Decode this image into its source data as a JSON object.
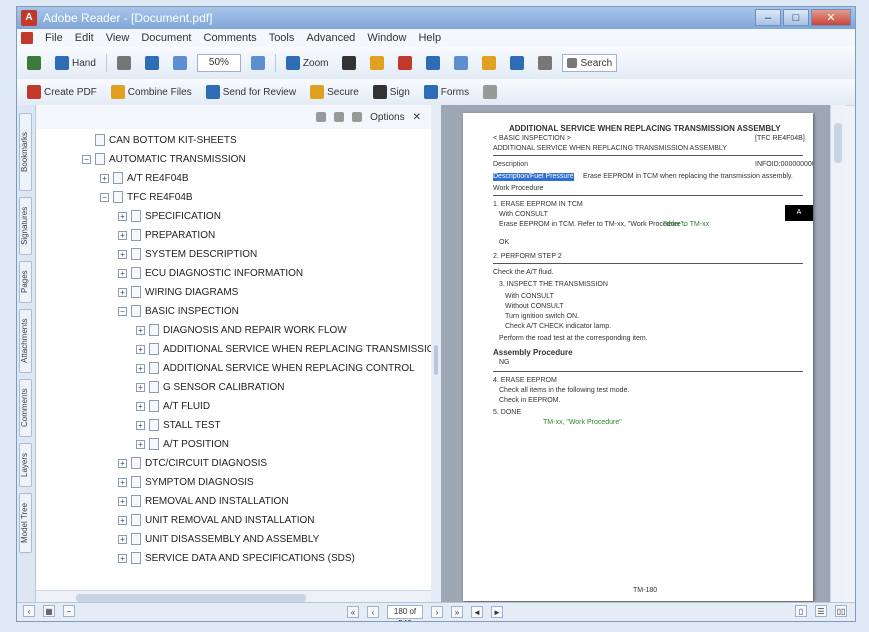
{
  "window": {
    "title": "Adobe Reader - [Document.pdf]",
    "icon": "adobe-reader-icon"
  },
  "window_buttons": {
    "minimize": "–",
    "maximize": "□",
    "close": "✕"
  },
  "menubar": {
    "items": [
      "File",
      "Edit",
      "View",
      "Document",
      "Comments",
      "Tools",
      "Advanced",
      "Window",
      "Help"
    ]
  },
  "toolbar1": {
    "items": [
      {
        "label": "",
        "icon": "save-icon",
        "color": "#3b7a3b"
      },
      {
        "label": "Hand",
        "icon": "hand-icon",
        "color": "#2e6db5"
      },
      {
        "label": "",
        "icon": "select-icon",
        "color": "#555"
      },
      {
        "label": "",
        "icon": "zoom-icon",
        "color": "#2e6db5"
      },
      {
        "label": "",
        "icon": "page-icon",
        "color": "#2e6db5"
      },
      {
        "label": "",
        "icon": "rotate-icon",
        "color": "#2e6db5"
      }
    ],
    "zoom": "50%",
    "right_items": [
      {
        "label": "Zoom",
        "icon": "zoom-in-icon",
        "color": "#2e6db5"
      },
      {
        "label": "",
        "icon": "monitor-icon",
        "color": "#333"
      },
      {
        "label": "",
        "icon": "folder-icon",
        "color": "#e0a020"
      },
      {
        "label": "",
        "icon": "print-icon",
        "color": "#c0392b"
      },
      {
        "label": "",
        "icon": "email-icon",
        "color": "#2e6db5"
      },
      {
        "label": "",
        "icon": "page-icon",
        "color": "#2e6db5"
      },
      {
        "label": "",
        "icon": "highlight-icon",
        "color": "#e0a020"
      },
      {
        "label": "",
        "icon": "pencil-icon",
        "color": "#2e6db5"
      },
      {
        "label": "",
        "icon": "lock-icon",
        "color": "#777"
      }
    ],
    "search_label": "Search"
  },
  "toolbar2": {
    "items": [
      {
        "label": "Create PDF",
        "icon": "create-pdf-icon",
        "color": "#c0392b"
      },
      {
        "label": "Combine Files",
        "icon": "combine-icon",
        "color": "#e0a020"
      },
      {
        "label": "Send for Review",
        "icon": "review-icon",
        "color": "#2e6db5"
      },
      {
        "label": "Secure",
        "icon": "lock-icon",
        "color": "#e0a020"
      },
      {
        "label": "Sign",
        "icon": "pen-icon",
        "color": "#333"
      },
      {
        "label": "Forms",
        "icon": "forms-icon",
        "color": "#2e6db5"
      },
      {
        "label": "",
        "icon": "more-icon",
        "color": "#333"
      }
    ]
  },
  "left_strip": {
    "tabs": [
      "Bookmarks",
      "Signatures",
      "Pages",
      "Attachments",
      "Comments",
      "Layers",
      "Model Tree"
    ]
  },
  "bookmarks_toolbar": {
    "options_label": "Options"
  },
  "bookmarks": [
    {
      "label": "CAN BOTTOM KIT-SHEETS",
      "level": 0,
      "expander": ""
    },
    {
      "label": "AUTOMATIC TRANSMISSION",
      "level": 0,
      "expander": "−"
    },
    {
      "label": "A/T RE4F04B",
      "level": 1,
      "expander": "+"
    },
    {
      "label": "TFC RE4F04B",
      "level": 1,
      "expander": "−"
    },
    {
      "label": "SPECIFICATION",
      "level": 2,
      "expander": "+"
    },
    {
      "label": "PREPARATION",
      "level": 2,
      "expander": "+"
    },
    {
      "label": "SYSTEM DESCRIPTION",
      "level": 2,
      "expander": "+"
    },
    {
      "label": "ECU DIAGNOSTIC INFORMATION",
      "level": 2,
      "expander": "+"
    },
    {
      "label": "WIRING DIAGRAMS",
      "level": 2,
      "expander": "+"
    },
    {
      "label": "BASIC INSPECTION",
      "level": 2,
      "expander": "−"
    },
    {
      "label": "DIAGNOSIS AND REPAIR WORK FLOW",
      "level": 3,
      "expander": "+"
    },
    {
      "label": "ADDITIONAL SERVICE WHEN REPLACING TRANSMISSION",
      "level": 3,
      "expander": "+"
    },
    {
      "label": "ADDITIONAL SERVICE WHEN REPLACING CONTROL",
      "level": 3,
      "expander": "+"
    },
    {
      "label": "G SENSOR CALIBRATION",
      "level": 3,
      "expander": "+"
    },
    {
      "label": "A/T FLUID",
      "level": 3,
      "expander": "+"
    },
    {
      "label": "STALL TEST",
      "level": 3,
      "expander": "+"
    },
    {
      "label": "A/T POSITION",
      "level": 3,
      "expander": "+"
    },
    {
      "label": "DTC/CIRCUIT DIAGNOSIS",
      "level": 2,
      "expander": "+"
    },
    {
      "label": "SYMPTOM DIAGNOSIS",
      "level": 2,
      "expander": "+"
    },
    {
      "label": "REMOVAL AND INSTALLATION",
      "level": 2,
      "expander": "+"
    },
    {
      "label": "UNIT REMOVAL AND INSTALLATION",
      "level": 2,
      "expander": "+"
    },
    {
      "label": "UNIT DISASSEMBLY AND ASSEMBLY",
      "level": 2,
      "expander": "+"
    },
    {
      "label": "SERVICE DATA AND SPECIFICATIONS (SDS)",
      "level": 2,
      "expander": "+"
    }
  ],
  "document": {
    "header_title": "ADDITIONAL SERVICE WHEN REPLACING TRANSMISSION ASSEMBLY",
    "header_left": "< BASIC INSPECTION >",
    "header_right": "[TFC RE4F04B]",
    "section_title": "ADDITIONAL SERVICE WHEN REPLACING TRANSMISSION ASSEMBLY",
    "label_description": "Description",
    "highlighted_text": "Description/Fuel Pressure",
    "desc_text": "Erase EEPROM in TCM when replacing the transmission assembly.",
    "work_procedure": "Work Procedure",
    "note_ref": "INFOID:0000000000000",
    "step1": "1. ERASE EEPROM IN TCM",
    "step1a": "With CONSULT",
    "step1b": "Erase EEPROM in TCM. Refer to TM-xx, \"Work Procedure\".",
    "box_text": "A",
    "step2": "2. PERFORM STEP 2",
    "check": "Check the A/T fluid.",
    "step3": "3. INSPECT THE TRANSMISSION",
    "items": [
      "With CONSULT",
      "Without CONSULT",
      "Turn ignition switch ON.",
      "Check A/T CHECK indicator lamp."
    ],
    "step4": "Perform the road test at the corresponding item.",
    "assembly_label": "Assembly Procedure",
    "ok_label": "OK",
    "ng_label": "NG",
    "step5": "4. ERASE EEPROM",
    "step5a": "Check all items in the following test mode.",
    "step5b": "Check in EEPROM.",
    "step6": "5. DONE",
    "green1": "Refer to TM-xx",
    "green2": "TM-xx, \"Work Procedure\"",
    "footer": "TM-180"
  },
  "statusbar": {
    "page_display": "180 of 542",
    "left_icons": [
      "nav-back-icon",
      "grid-icon",
      "zoom-out-icon"
    ],
    "center_icons": [
      "first-page-icon",
      "prev-page-icon",
      "next-page-icon",
      "last-page-icon",
      "back-icon",
      "forward-icon"
    ],
    "right_icons": [
      "single-page-icon",
      "continuous-icon",
      "facing-icon"
    ]
  }
}
